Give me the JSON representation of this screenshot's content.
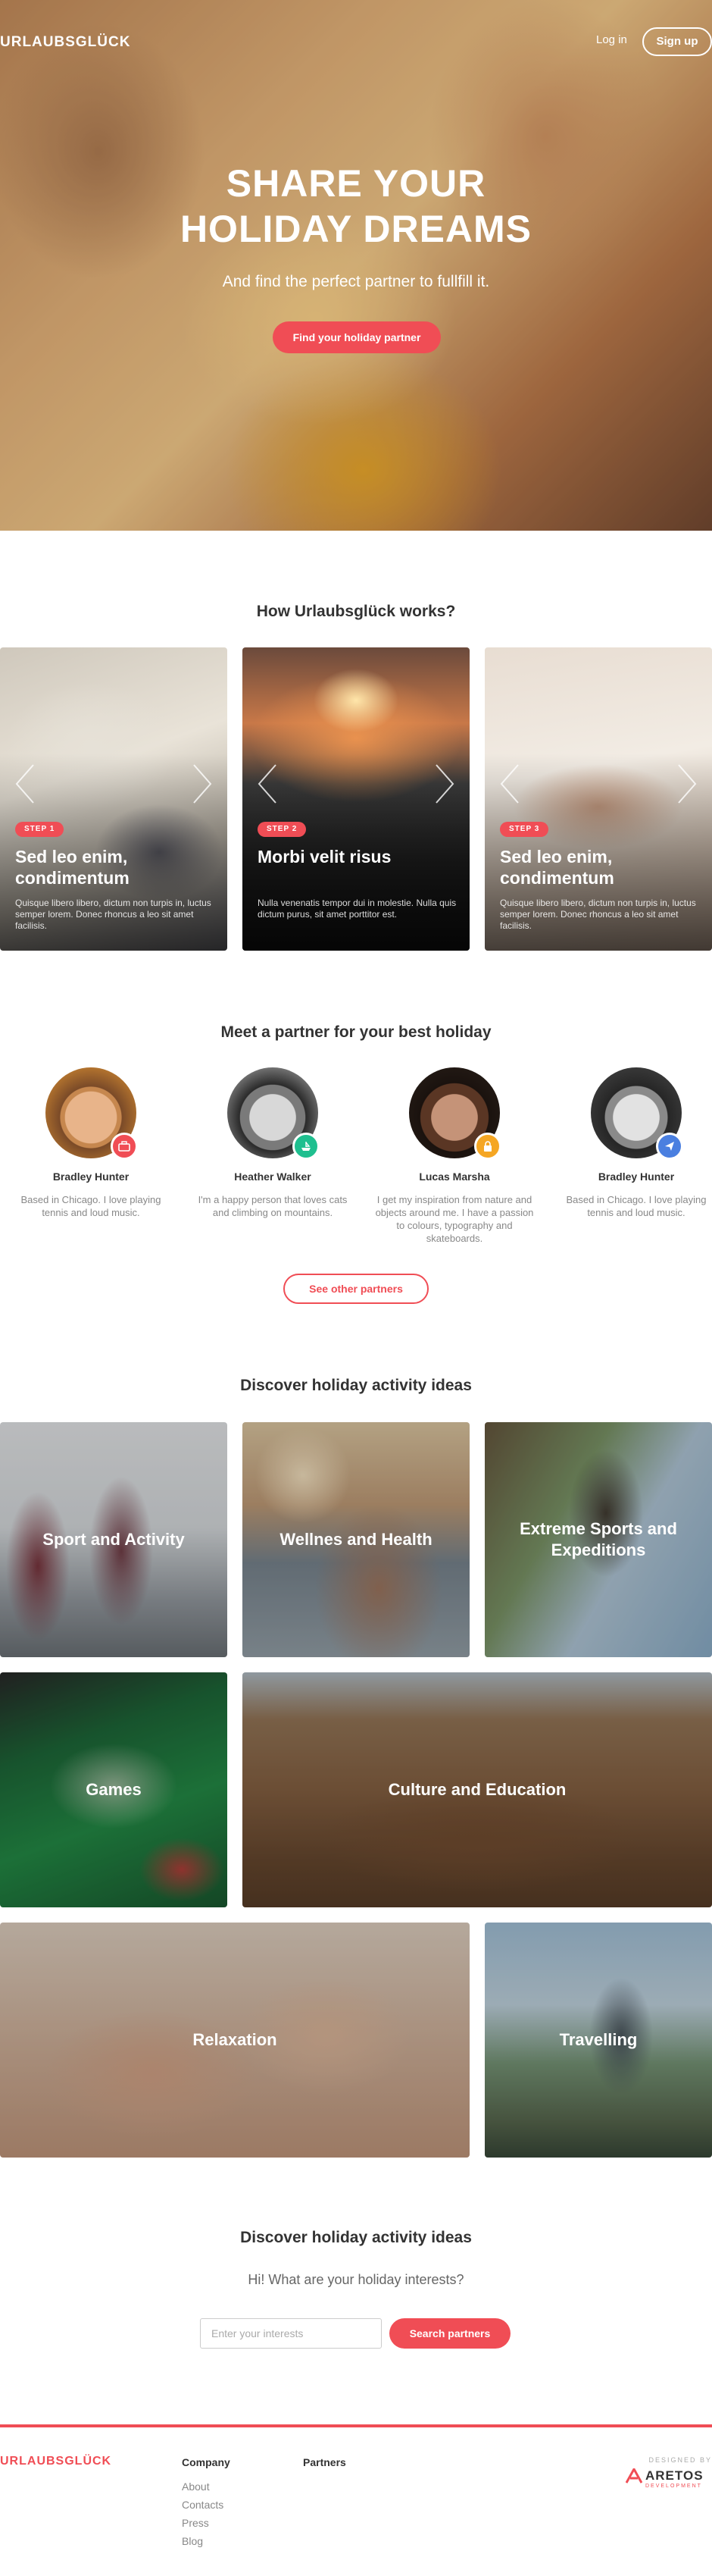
{
  "hero": {
    "logo": "URLAUBSGLÜCK",
    "login": "Log in",
    "signup": "Sign up",
    "title_line1": "SHARE YOUR",
    "title_line2": "HOLIDAY DREAMS",
    "subtitle": "And find the perfect partner to fullfill it.",
    "cta": "Find your holiday partner"
  },
  "how": {
    "title": "How Urlaubsglück works?",
    "steps": [
      {
        "badge": "STEP 1",
        "title": "Sed leo enim, condimentum",
        "text": "Quisque libero libero, dictum non turpis in, luctus semper lorem. Donec rhoncus a leo sit amet facilisis."
      },
      {
        "badge": "STEP 2",
        "title": "Morbi velit risus",
        "text": "Nulla venenatis tempor dui in molestie. Nulla quis dictum purus, sit amet porttitor est."
      },
      {
        "badge": "STEP 3",
        "title": "Sed leo enim, condimentum",
        "text": "Quisque libero libero, dictum non turpis in, luctus semper lorem. Donec rhoncus a leo sit amet facilisis."
      }
    ]
  },
  "partners": {
    "title": "Meet a partner for your best holiday",
    "items": [
      {
        "name": "Bradley Hunter",
        "desc": "Based in Chicago. I love playing tennis and loud music.",
        "badge_icon": "suitcase-icon",
        "badge_color": "#f04d55"
      },
      {
        "name": "Heather Walker",
        "desc": "I'm a happy person that loves cats and climbing on mountains.",
        "badge_icon": "boat-icon",
        "badge_color": "#1fbf8f"
      },
      {
        "name": "Lucas Marsha",
        "desc": "I get my inspiration from nature and objects around me. I have a passion to colours, typography and skateboards.",
        "badge_icon": "lock-icon",
        "badge_color": "#f5a623"
      },
      {
        "name": "Bradley Hunter",
        "desc": "Based in Chicago. I love playing tennis and loud music.",
        "badge_icon": "plane-icon",
        "badge_color": "#4a7fe0"
      }
    ],
    "more": "See other partners"
  },
  "activities": {
    "title": "Discover holiday activity ideas",
    "items": [
      "Sport and Activity",
      "Wellnes and Health",
      "Extreme Sports and Expeditions",
      "Games",
      "Culture and Education",
      "Relaxation",
      "Travelling"
    ]
  },
  "interests": {
    "title": "Discover holiday activity ideas",
    "intro": "Hi! What are your holiday interests?",
    "placeholder": "Enter your interests",
    "button": "Search partners"
  },
  "footer": {
    "logo": "URLAUBSGLÜCK",
    "company_heading": "Company",
    "company_links": [
      "About",
      "Contacts",
      "Press",
      "Blog"
    ],
    "partners_heading": "Partners",
    "designed_by": "DESIGNED BY",
    "brand": "ARETOS",
    "brand_sub": "DEVELOPMENT"
  },
  "colors": {
    "accent": "#f04d55"
  }
}
